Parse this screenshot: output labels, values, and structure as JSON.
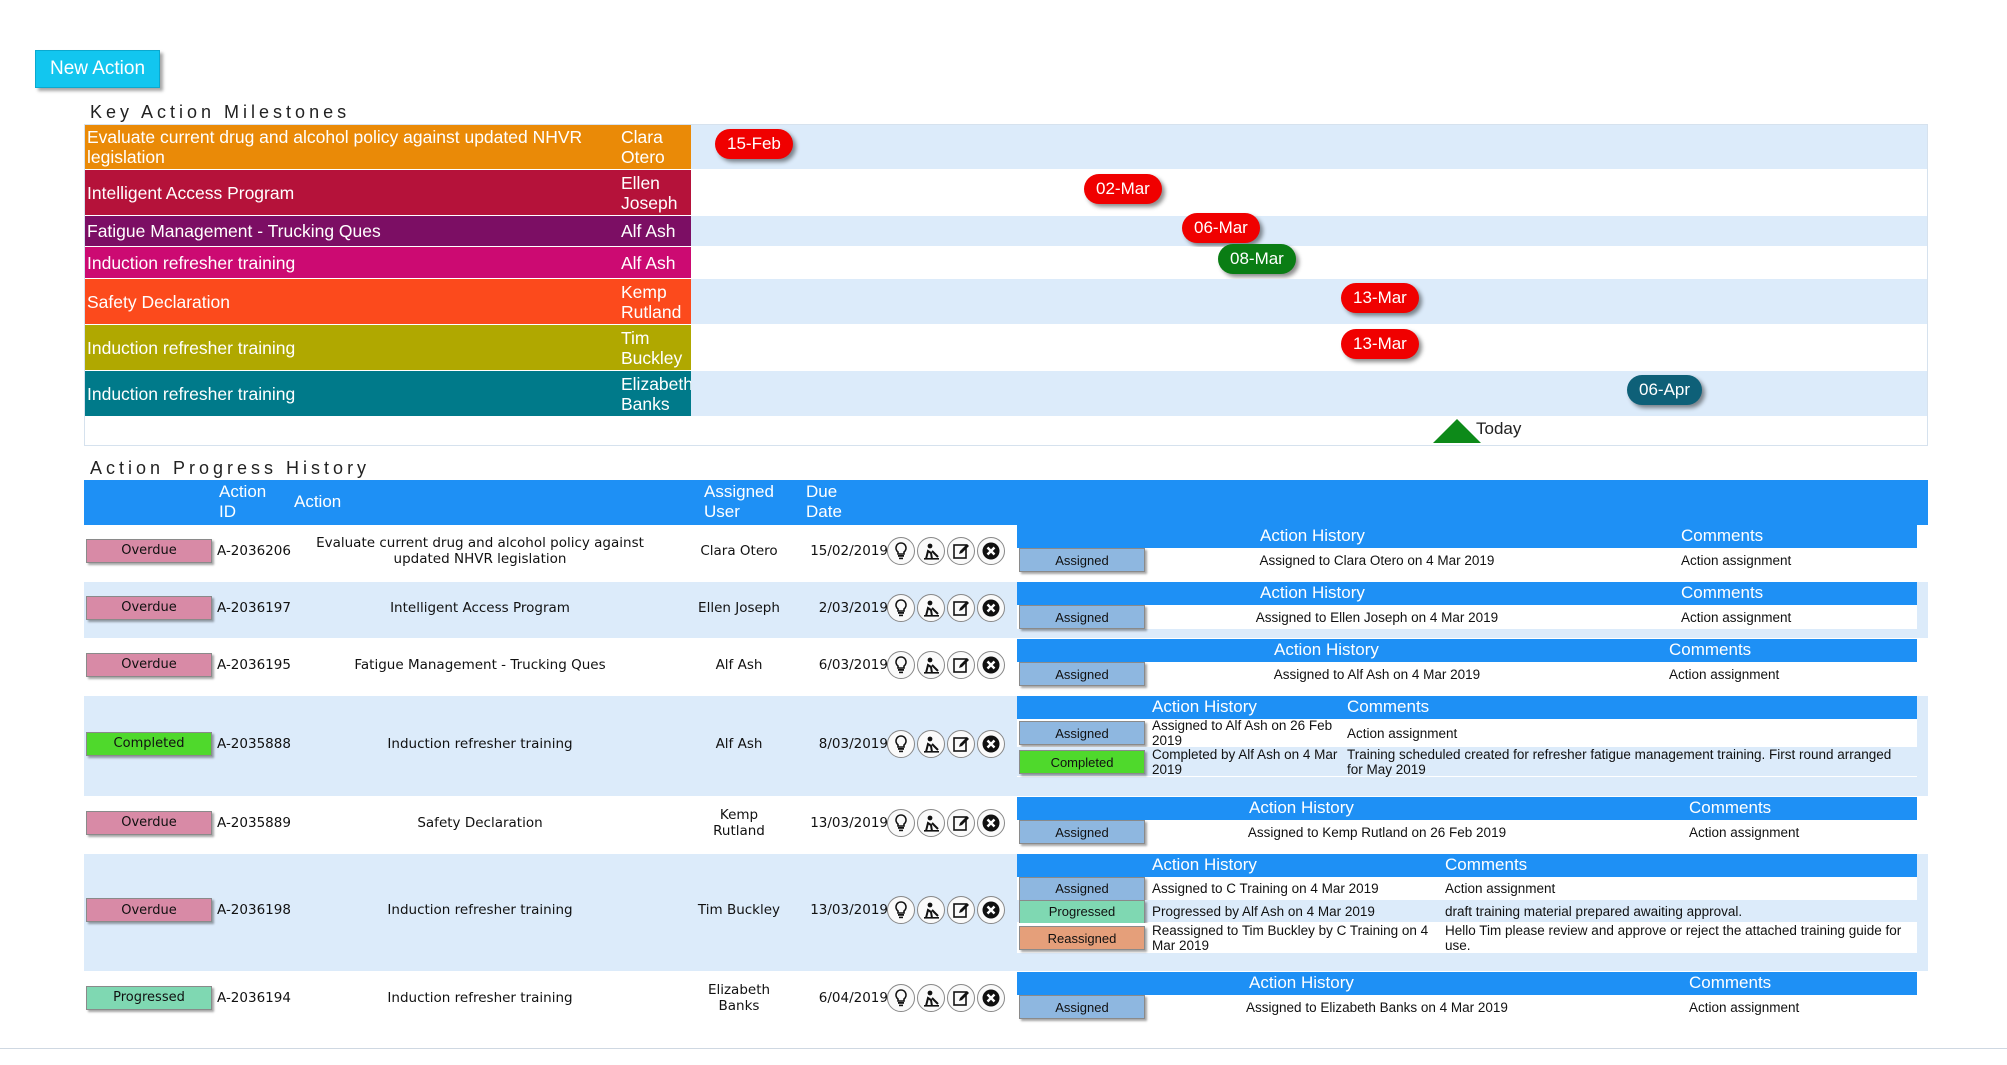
{
  "toolbar": {
    "new_action_label": "New Action"
  },
  "milestones": {
    "title": "Key Action Milestones",
    "today_label": "Today",
    "rows": [
      {
        "action": "Evaluate current drug and alcohol policy against updated NHVR legislation",
        "user": "Clara Otero",
        "due": "15-Feb",
        "label_color": "#ea8a07",
        "pill_color": "#f00000"
      },
      {
        "action": "Intelligent Access Program",
        "user": "Ellen Joseph",
        "due": "02-Mar",
        "label_color": "#b5123a",
        "pill_color": "#f00000"
      },
      {
        "action": "Fatigue Management - Trucking Ques",
        "user": "Alf Ash",
        "due": "06-Mar",
        "label_color": "#7c0e64",
        "pill_color": "#f00000"
      },
      {
        "action": "Induction refresher training",
        "user": "Alf Ash",
        "due": "08-Mar",
        "label_color": "#cc0a72",
        "pill_color": "#0a7d14"
      },
      {
        "action": "Safety Declaration",
        "user": "Kemp Rutland",
        "due": "13-Mar",
        "label_color": "#fc4a1c",
        "pill_color": "#f00000"
      },
      {
        "action": "Induction refresher training",
        "user": "Tim Buckley",
        "due": "13-Mar",
        "label_color": "#b0a800",
        "pill_color": "#f00000"
      },
      {
        "action": "Induction refresher training",
        "user": "Elizabeth Banks",
        "due": "06-Apr",
        "label_color": "#007a8a",
        "pill_color": "#0e6078"
      }
    ]
  },
  "progress": {
    "title": "Action Progress History",
    "headers": {
      "action_id": "Action ID",
      "action": "Action",
      "assigned_user": "Assigned User",
      "due_date": "Due Date"
    },
    "history_header": "Action History",
    "comments_header": "Comments",
    "status_colors": {
      "Overdue": "#d88aa6",
      "Completed": "#4fd92c",
      "Progressed": "#7fd8b2",
      "Assigned": "#8eb7e0",
      "Reassigned": "#e59f7a"
    },
    "rows": [
      {
        "status": "Overdue",
        "id": "A-2036206",
        "action": "Evaluate current drug and alcohol policy against updated NHVR legislation",
        "user": "Clara Otero",
        "due": "15/02/2019",
        "history": [
          {
            "status": "Assigned",
            "text": "Assigned to Clara Otero on 4 Mar 2019",
            "comment": "Action assignment"
          }
        ]
      },
      {
        "status": "Overdue",
        "id": "A-2036197",
        "action": "Intelligent Access Program",
        "user": "Ellen Joseph",
        "due": "2/03/2019",
        "history": [
          {
            "status": "Assigned",
            "text": "Assigned to Ellen Joseph on 4 Mar 2019",
            "comment": "Action assignment"
          }
        ]
      },
      {
        "status": "Overdue",
        "id": "A-2036195",
        "action": "Fatigue Management - Trucking Ques",
        "user": "Alf Ash",
        "due": "6/03/2019",
        "history": [
          {
            "status": "Assigned",
            "text": "Assigned to Alf Ash on 4 Mar 2019",
            "comment": "Action assignment"
          }
        ]
      },
      {
        "status": "Completed",
        "id": "A-2035888",
        "action": "Induction refresher training",
        "user": "Alf Ash",
        "due": "8/03/2019",
        "history": [
          {
            "status": "Assigned",
            "text": "Assigned to Alf Ash on 26 Feb 2019",
            "comment": "Action assignment"
          },
          {
            "status": "Completed",
            "text": "Completed by Alf Ash on 4 Mar 2019",
            "comment": "Training scheduled created for refresher fatigue management training. First round arranged for May 2019"
          }
        ]
      },
      {
        "status": "Overdue",
        "id": "A-2035889",
        "action": "Safety Declaration",
        "user": "Kemp Rutland",
        "due": "13/03/2019",
        "history": [
          {
            "status": "Assigned",
            "text": "Assigned to Kemp Rutland on 26 Feb 2019",
            "comment": "Action assignment"
          }
        ]
      },
      {
        "status": "Overdue",
        "id": "A-2036198",
        "action": "Induction refresher training",
        "user": "Tim Buckley",
        "due": "13/03/2019",
        "history": [
          {
            "status": "Assigned",
            "text": "Assigned to C Training on 4 Mar 2019",
            "comment": "Action assignment"
          },
          {
            "status": "Progressed",
            "text": "Progressed by Alf Ash on 4 Mar 2019",
            "comment": "draft training material prepared awaiting approval."
          },
          {
            "status": "Reassigned",
            "text": "Reassigned to Tim Buckley by C Training on 4 Mar 2019",
            "comment": "Hello Tim please review and approve or reject the attached training guide for use."
          }
        ]
      },
      {
        "status": "Progressed",
        "id": "A-2036194",
        "action": "Induction refresher training",
        "user": "Elizabeth Banks",
        "due": "6/04/2019",
        "history": [
          {
            "status": "Assigned",
            "text": "Assigned to Elizabeth Banks on 4 Mar 2019",
            "comment": "Action assignment"
          }
        ]
      }
    ]
  }
}
